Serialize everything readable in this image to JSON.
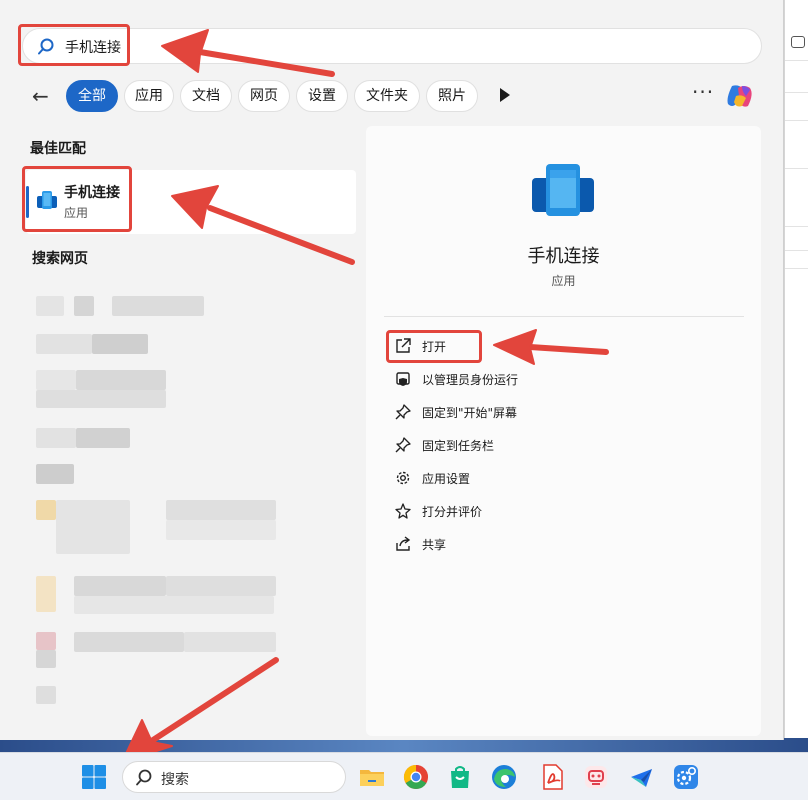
{
  "search": {
    "query": "手机连接"
  },
  "filters": {
    "back": "←",
    "chips": [
      "全部",
      "应用",
      "文档",
      "网页",
      "设置",
      "文件夹",
      "照片"
    ],
    "more": "···"
  },
  "best_match": {
    "section_title": "最佳匹配",
    "app_name": "手机连接",
    "app_type": "应用"
  },
  "web_results": {
    "section_title": "搜索网页"
  },
  "preview": {
    "app_name": "手机连接",
    "app_type": "应用",
    "actions": [
      {
        "label": "打开",
        "icon": "open-external-icon"
      },
      {
        "label": "以管理员身份运行",
        "icon": "admin-shield-icon"
      },
      {
        "label": "固定到\"开始\"屏幕",
        "icon": "pin-icon"
      },
      {
        "label": "固定到任务栏",
        "icon": "pin-icon"
      },
      {
        "label": "应用设置",
        "icon": "gear-icon"
      },
      {
        "label": "打分并评价",
        "icon": "star-rating-icon"
      },
      {
        "label": "共享",
        "icon": "share-icon"
      }
    ]
  },
  "taskbar": {
    "search_placeholder": "搜索",
    "apps": [
      "file-explorer-icon",
      "chrome-icon",
      "store-bag-icon",
      "edge-icon",
      "pdf-reader-icon",
      "robot-app-icon",
      "feishu-icon",
      "settings-app-icon"
    ]
  },
  "colors": {
    "accent": "#1d67c7",
    "annotation_red": "#e2453c"
  }
}
